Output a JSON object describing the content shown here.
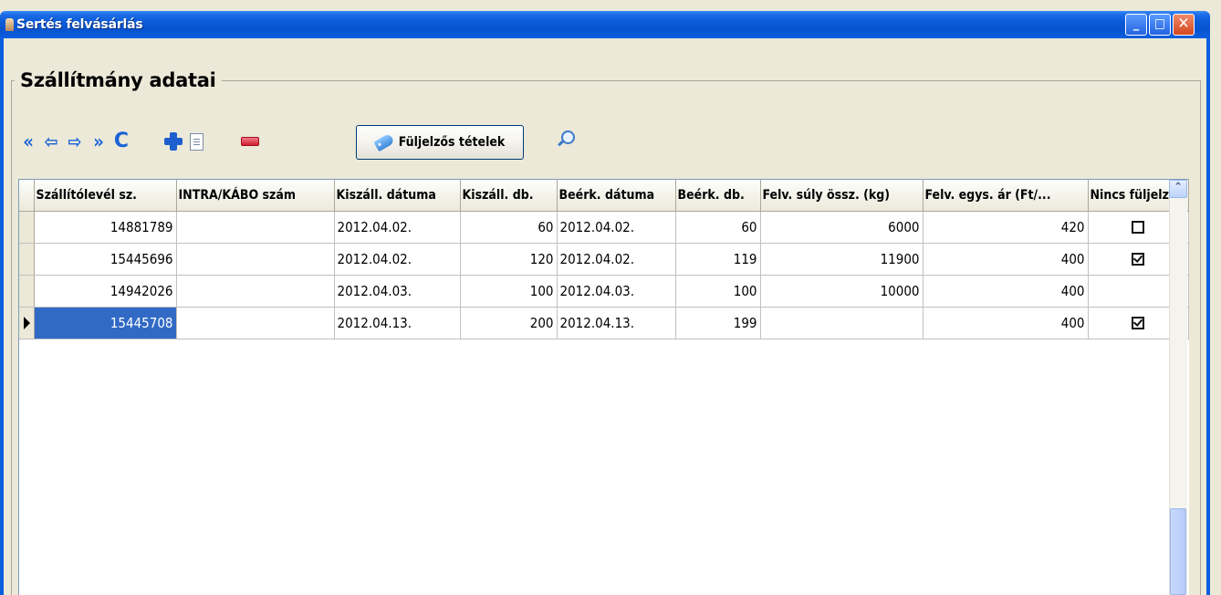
{
  "window": {
    "title": "Sertés felvásárlás",
    "minimize": "_",
    "maximize": "□",
    "close": "✕"
  },
  "group": {
    "title": "Szállítmány adatai"
  },
  "toolbar": {
    "first": "«",
    "prev": "⇦",
    "next": "⇨",
    "last": "»",
    "refresh": "C",
    "label_button": "Füljelzős tételek"
  },
  "table": {
    "columns": [
      "",
      "Szállítólevél sz.",
      "INTRA/KÁBO szám",
      "Kiszáll. dátuma",
      "Kiszáll. db.",
      "Beérk. dátuma",
      "Beérk. db.",
      "Felv. súly össz. (kg)",
      "Felv. egys. ár (Ft/...",
      "Nincs füljelz"
    ],
    "rows": [
      {
        "szallitolevel": "14881789",
        "intra": "",
        "kiszall_datum": "2012.04.02.",
        "kiszall_db": "60",
        "beerk_datum": "2012.04.02.",
        "beerk_db": "60",
        "suly": "6000",
        "ar": "420",
        "nincs_fuljelzo": "unchecked"
      },
      {
        "szallitolevel": "15445696",
        "intra": "",
        "kiszall_datum": "2012.04.02.",
        "kiszall_db": "120",
        "beerk_datum": "2012.04.02.",
        "beerk_db": "119",
        "suly": "11900",
        "ar": "400",
        "nincs_fuljelzo": "checked"
      },
      {
        "szallitolevel": "14942026",
        "intra": "",
        "kiszall_datum": "2012.04.03.",
        "kiszall_db": "100",
        "beerk_datum": "2012.04.03.",
        "beerk_db": "100",
        "suly": "10000",
        "ar": "400",
        "nincs_fuljelzo": "none"
      },
      {
        "szallitolevel": "15445708",
        "intra": "",
        "kiszall_datum": "2012.04.13.",
        "kiszall_db": "200",
        "beerk_datum": "2012.04.13.",
        "beerk_db": "199",
        "suly": "",
        "ar": "400",
        "nincs_fuljelzo": "checked"
      }
    ],
    "selected_row": 3
  },
  "scrollbar": {
    "up": "⌃"
  },
  "colors": {
    "titlebar": "#0a5ad8",
    "selection": "#316ac5",
    "window_bg": "#ece9d8"
  }
}
